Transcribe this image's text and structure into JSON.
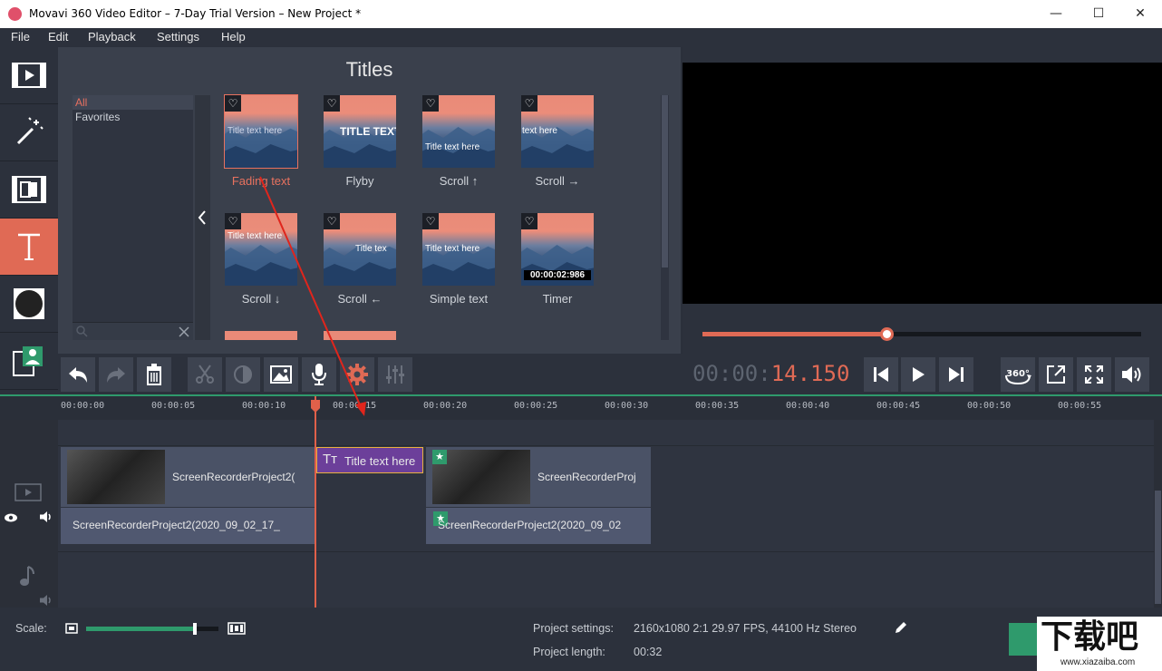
{
  "window": {
    "title": "Movavi 360 Video Editor – 7-Day Trial Version – New Project *",
    "min": "—",
    "max": "☐",
    "close": "✕"
  },
  "menu": [
    "File",
    "Edit",
    "Playback",
    "Settings",
    "Help"
  ],
  "panel": {
    "title": "Titles",
    "categories": [
      "All",
      "Favorites"
    ],
    "tiles": [
      {
        "label": "Fading text",
        "overlay": "Title text here"
      },
      {
        "label": "Flyby",
        "overlay": "TITLE TEXT H"
      },
      {
        "label": "Scroll ↑",
        "overlay": "Title text here"
      },
      {
        "label": "Scroll →",
        "overlay": "text here"
      },
      {
        "label": "Scroll ↓",
        "overlay": "Title text here"
      },
      {
        "label": "Scroll ←",
        "overlay": "Title tex"
      },
      {
        "label": "Simple text",
        "overlay": "Title text here"
      },
      {
        "label": "Timer",
        "overlay": "00:00:02:986"
      }
    ]
  },
  "player": {
    "timecode_main": "00:00:",
    "timecode_accent": "14.150",
    "progress": 0.42
  },
  "ruler": [
    "00:00:00",
    "00:00:05",
    "00:00:10",
    "00:00:15",
    "00:00:20",
    "00:00:25",
    "00:00:30",
    "00:00:35",
    "00:00:40",
    "00:00:45",
    "00:00:50",
    "00:00:55"
  ],
  "clips": {
    "video1": "ScreenRecorderProject2(",
    "audio1": "ScreenRecorderProject2(2020_09_02_17_",
    "title": "Title text here",
    "video2": "ScreenRecorderProj",
    "audio2": "ScreenRecorderProject2(2020_09_02"
  },
  "status": {
    "scale_label": "Scale:",
    "scale": 0.82,
    "settings_label": "Project settings:",
    "settings_value": "2160x1080 2:1 29.97 FPS, 44100 Hz Stereo",
    "length_label": "Project length:",
    "length_value": "00:32"
  },
  "watermark": {
    "text": "下载吧",
    "url": "www.xiazaiba.com"
  },
  "colors": {
    "accent": "#e06a55",
    "timeline": "#2f9a6c",
    "title_clip": "#6c3f9a"
  }
}
